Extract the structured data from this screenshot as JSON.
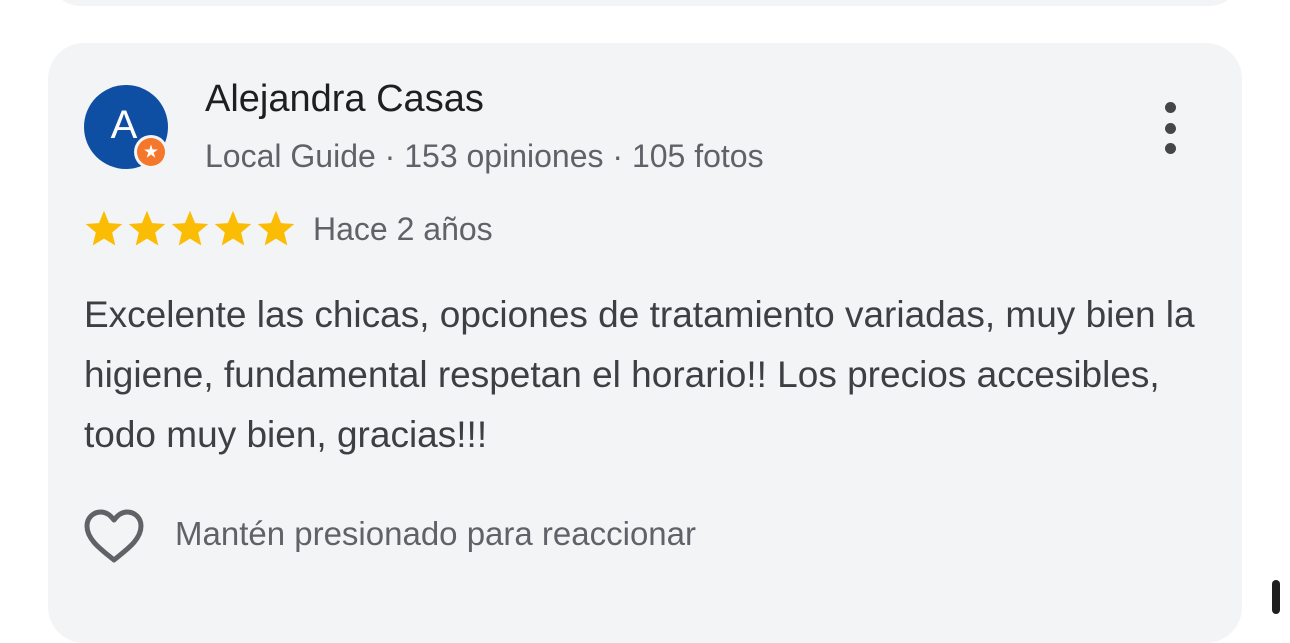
{
  "review": {
    "avatar_letter": "A",
    "reviewer_name": "Alejandra Casas",
    "reviewer_meta": "Local Guide · 153 opiniones · 105 fotos",
    "rating": 5,
    "rating_max": 5,
    "time_ago": "Hace 2 años",
    "text": "Excelente las chicas, opciones de tratamiento variadas, muy bien la higiene, fundamental respetan el horario!! Los precios accesibles, todo muy bien, gracias!!!",
    "react_hint": "Mantén presionado para reaccionar"
  },
  "icons": {
    "badge": "local-guide-badge-icon",
    "more": "more-vertical-icon",
    "star": "star-filled-icon",
    "heart": "heart-outline-icon"
  },
  "colors": {
    "card_background": "#f3f4f6",
    "avatar_background": "#0f4fa3",
    "badge_orange": "#f4772b",
    "star_yellow": "#fbbc04",
    "primary_text": "#1f1f1f",
    "secondary_text": "#5f6368"
  }
}
